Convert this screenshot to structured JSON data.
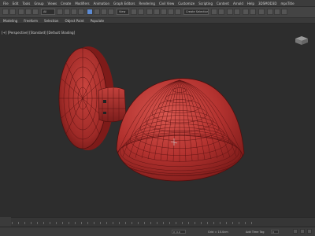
{
  "menu": {
    "items": [
      "File",
      "Edit",
      "Tools",
      "Group",
      "Views",
      "Create",
      "Modifiers",
      "Animation",
      "Graph Editors",
      "Rendering",
      "Civil View",
      "Customize",
      "Scripting",
      "Content",
      "Arnold",
      "Help",
      "3DSMOD3D",
      "mpsTitle"
    ]
  },
  "toolbar": {
    "selection_filter": "All",
    "view_dropdown": "View",
    "named_selection": "Create Selection Set"
  },
  "ribbon": {
    "tabs": [
      "Modeling",
      "Freeform",
      "Selection",
      "Object Paint",
      "Populate"
    ]
  },
  "viewport": {
    "label": "[+] [Perspective] [Standard] [Default Shading]",
    "object_color": "#b3322f",
    "wire_color": "#5a1212",
    "background": "#2d2d2d"
  },
  "status": {
    "coords": "X: 0.0",
    "grid": "Grid = 10.0cm",
    "add_time_tag": "Add Time Tag",
    "frame": "0",
    "lock": "lock"
  },
  "colors": {
    "accent": "#5d8bd3",
    "ui_bg": "#3c3c3c"
  }
}
